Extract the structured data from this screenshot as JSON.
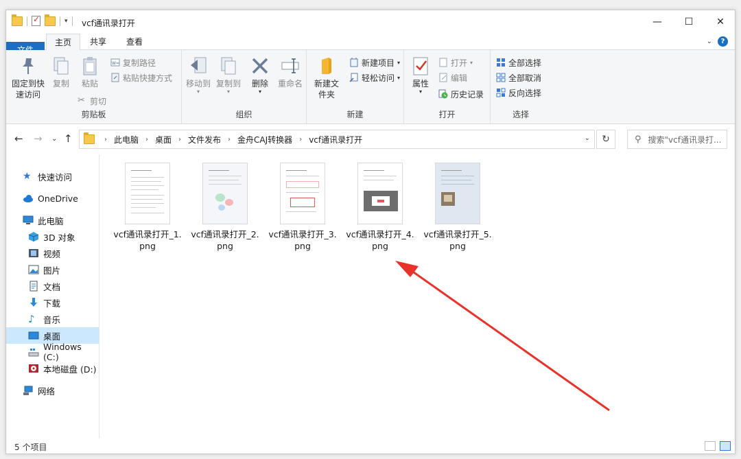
{
  "window": {
    "title": "vcf通讯录打开",
    "minimize": "—",
    "maximize": "☐",
    "close": "✕"
  },
  "tabs": {
    "file": "文件",
    "home": "主页",
    "share": "共享",
    "view": "查看"
  },
  "ribbon": {
    "clipboard": {
      "label": "剪贴板",
      "pin": "固定到快速访问",
      "copy": "复制",
      "paste": "粘贴",
      "copy_path": "复制路径",
      "paste_shortcut": "粘贴快捷方式",
      "cut": "剪切"
    },
    "organize": {
      "label": "组织",
      "move_to": "移动到",
      "copy_to": "复制到",
      "delete": "删除",
      "rename": "重命名"
    },
    "new": {
      "label": "新建",
      "new_folder": "新建文件夹",
      "new_item": "新建项目",
      "easy_access": "轻松访问"
    },
    "open": {
      "label": "打开",
      "properties": "属性",
      "open": "打开",
      "edit": "编辑",
      "history": "历史记录"
    },
    "select": {
      "label": "选择",
      "select_all": "全部选择",
      "select_none": "全部取消",
      "invert": "反向选择"
    }
  },
  "address": {
    "crumbs": [
      "此电脑",
      "桌面",
      "文件发布",
      "金舟CAJ转换器",
      "vcf通讯录打开"
    ],
    "search_placeholder": "搜索\"vcf通讯录打..."
  },
  "nav": {
    "quick_access": "快速访问",
    "onedrive": "OneDrive",
    "this_pc": "此电脑",
    "objects_3d": "3D 对象",
    "videos": "视频",
    "pictures": "图片",
    "documents": "文档",
    "downloads": "下载",
    "music": "音乐",
    "desktop": "桌面",
    "windows_c": "Windows (C:)",
    "local_d": "本地磁盘 (D:)",
    "network": "网络"
  },
  "files": [
    {
      "name": "vcf通讯录打开_1.png"
    },
    {
      "name": "vcf通讯录打开_2.png"
    },
    {
      "name": "vcf通讯录打开_3.png"
    },
    {
      "name": "vcf通讯录打开_4.png"
    },
    {
      "name": "vcf通讯录打开_5.png"
    }
  ],
  "status": {
    "count": "5 个项目"
  },
  "colors": {
    "accent": "#1a6fc4",
    "selection": "#cce8ff",
    "annotation_arrow": "#e8322a"
  }
}
